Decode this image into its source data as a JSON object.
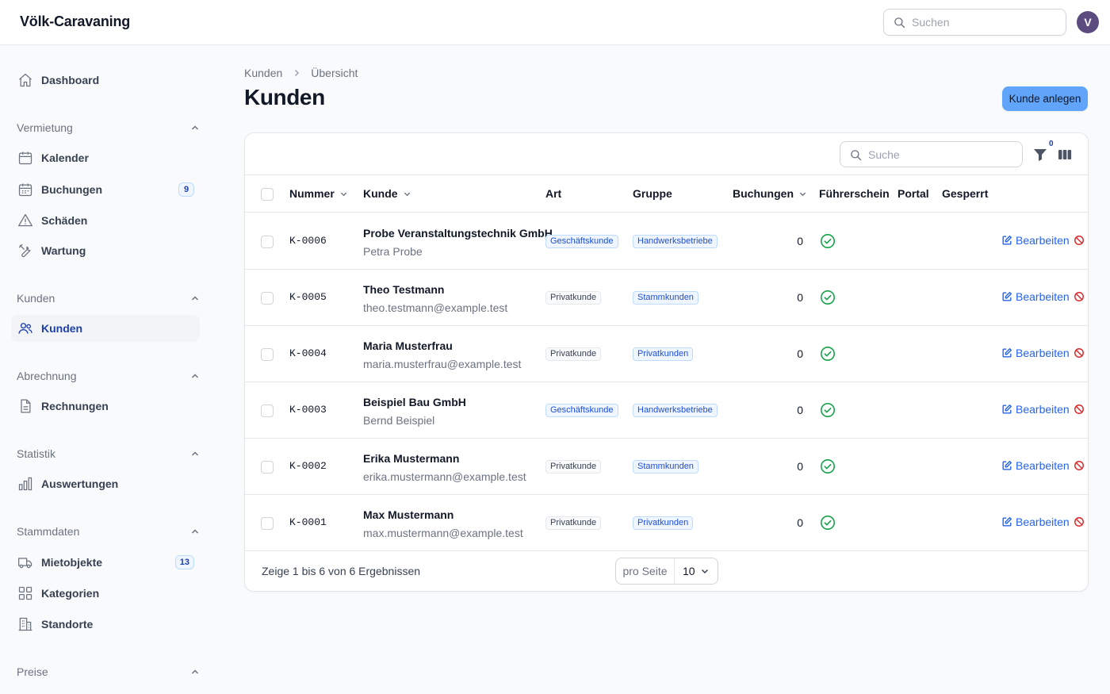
{
  "app": {
    "brand": "Völk-Caravaning",
    "search_placeholder": "Suchen",
    "avatar_initial": "V"
  },
  "sidebar": {
    "dashboard": "Dashboard",
    "groups": [
      {
        "label": "Vermietung",
        "items": [
          {
            "label": "Kalender",
            "icon": "calendar-icon"
          },
          {
            "label": "Buchungen",
            "icon": "calendar-grid-icon",
            "badge": "9"
          },
          {
            "label": "Schäden",
            "icon": "warning-icon"
          },
          {
            "label": "Wartung",
            "icon": "wrench-icon"
          }
        ]
      },
      {
        "label": "Kunden",
        "items": [
          {
            "label": "Kunden",
            "icon": "users-icon",
            "active": true
          }
        ]
      },
      {
        "label": "Abrechnung",
        "items": [
          {
            "label": "Rechnungen",
            "icon": "document-icon"
          }
        ]
      },
      {
        "label": "Statistik",
        "items": [
          {
            "label": "Auswertungen",
            "icon": "bar-chart-icon"
          }
        ]
      },
      {
        "label": "Stammdaten",
        "items": [
          {
            "label": "Mietobjekte",
            "icon": "truck-icon",
            "badge": "13"
          },
          {
            "label": "Kategorien",
            "icon": "grid-icon"
          },
          {
            "label": "Standorte",
            "icon": "building-icon"
          }
        ]
      },
      {
        "label": "Preise",
        "items": []
      }
    ]
  },
  "page": {
    "breadcrumb": [
      "Kunden",
      "Übersicht"
    ],
    "title": "Kunden",
    "create_button": "Kunde anlegen"
  },
  "table": {
    "search_placeholder": "Suche",
    "filter_count": "0",
    "columns": [
      "Nummer",
      "Kunde",
      "Art",
      "Gruppe",
      "Buchungen",
      "Führerschein",
      "Portal",
      "Gesperrt"
    ],
    "rows": [
      {
        "number": "K-0006",
        "name": "Probe Veranstaltungstechnik GmbH",
        "sub": "Petra Probe",
        "type": "Geschäftskunde",
        "type_style": "blue",
        "group": "Handwerksbetriebe",
        "bookings": "0",
        "license": true
      },
      {
        "number": "K-0005",
        "name": "Theo Testmann",
        "sub": "theo.testmann@example.test",
        "type": "Privatkunde",
        "type_style": "gray",
        "group": "Stammkunden",
        "bookings": "0",
        "license": true
      },
      {
        "number": "K-0004",
        "name": "Maria Musterfrau",
        "sub": "maria.musterfrau@example.test",
        "type": "Privatkunde",
        "type_style": "gray",
        "group": "Privatkunden",
        "bookings": "0",
        "license": true
      },
      {
        "number": "K-0003",
        "name": "Beispiel Bau GmbH",
        "sub": "Bernd Beispiel",
        "type": "Geschäftskunde",
        "type_style": "blue",
        "group": "Handwerksbetriebe",
        "bookings": "0",
        "license": true
      },
      {
        "number": "K-0002",
        "name": "Erika Mustermann",
        "sub": "erika.mustermann@example.test",
        "type": "Privatkunde",
        "type_style": "gray",
        "group": "Stammkunden",
        "bookings": "0",
        "license": true
      },
      {
        "number": "K-0001",
        "name": "Max Mustermann",
        "sub": "max.mustermann@example.test",
        "type": "Privatkunde",
        "type_style": "gray",
        "group": "Privatkunden",
        "bookings": "0",
        "license": true
      }
    ],
    "edit_label": "Bearbeiten",
    "lock_label": "S",
    "footer": "Zeige 1 bis 6 von 6 Ergebnissen",
    "per_page_label": "pro Seite",
    "per_page_value": "10"
  },
  "colors": {
    "accent": "#2563eb",
    "primary_button": "#60a5fa",
    "success": "#16a34a",
    "danger": "#dc2626"
  }
}
